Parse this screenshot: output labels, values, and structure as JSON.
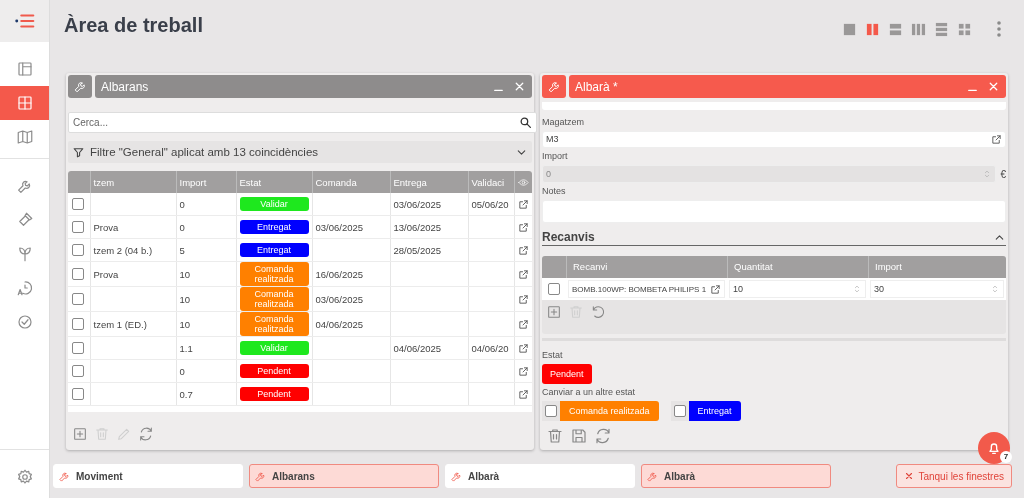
{
  "sidebar": {
    "menu_button": {
      "selected": false
    },
    "top_items": [
      {
        "selected": false
      },
      {
        "selected": true
      },
      {
        "selected": false
      }
    ],
    "tool_items": [
      {
        "selected": false
      },
      {
        "selected": false
      },
      {
        "selected": false
      },
      {
        "selected": false
      },
      {
        "selected": false
      }
    ],
    "settings": {
      "selected": false
    }
  },
  "title": "Àrea de treball",
  "layout_switcher": [
    {
      "selected": false
    },
    {
      "selected": true
    },
    {
      "selected": false
    },
    {
      "selected": false
    },
    {
      "selected": false
    },
    {
      "selected": false
    }
  ],
  "list_panel": {
    "title": "Albarans",
    "active": false,
    "search": {
      "placeholder": "Cerca..."
    },
    "filter": {
      "text": "Filtre \"General\" aplicat amb 13 coincidències",
      "expanded": false
    },
    "table": {
      "columns": [
        "tzem",
        "Import",
        "Estat",
        "Comanda",
        "Entrega",
        "Validaci"
      ],
      "rows": [
        {
          "checked": false,
          "import": "0",
          "status": {
            "label": "Validar",
            "color": "#1ee81e"
          },
          "entrega": "03/06/2025",
          "validacio": "05/06/20"
        },
        {
          "checked": false,
          "column_1": "Prova",
          "import": "0",
          "status": {
            "label": "Entregat",
            "color": "#0000ff"
          },
          "comanda": "03/06/2025",
          "entrega": "13/06/2025"
        },
        {
          "checked": false,
          "column_1": "tzem 2 (04 b.)",
          "import": "5",
          "status": {
            "label": "Entregat",
            "color": "#0000ff"
          },
          "entrega": "28/05/2025"
        },
        {
          "checked": false,
          "column_1": "Prova",
          "import": "10",
          "status": {
            "label": "Comanda realitzada",
            "color": "#ff8000"
          },
          "comanda": "16/06/2025"
        },
        {
          "checked": false,
          "import": "10",
          "status": {
            "label": "Comanda realitzada",
            "color": "#ff8000"
          },
          "comanda": "03/06/2025"
        },
        {
          "checked": false,
          "column_1": "tzem 1 (ED.)",
          "import": "10",
          "status": {
            "label": "Comanda realitzada",
            "color": "#ff8000"
          },
          "comanda": "04/06/2025"
        },
        {
          "checked": false,
          "import": "1.1",
          "status": {
            "label": "Validar",
            "color": "#1ee81e"
          },
          "entrega": "04/06/2025",
          "validacio": "04/06/20"
        },
        {
          "checked": false,
          "import": "0",
          "status": {
            "label": "Pendent",
            "color": "#ff0000"
          }
        },
        {
          "checked": false,
          "import": "0.7",
          "status": {
            "label": "Pendent",
            "color": "#ff0000"
          }
        }
      ]
    },
    "toolbar": [
      {
        "disabled": false
      },
      {
        "disabled": true
      },
      {
        "disabled": true
      },
      {
        "disabled": false
      }
    ]
  },
  "detail_panel": {
    "title": "Albarà *",
    "active": true,
    "fields": [
      {
        "label": "Magatzem",
        "value": "M3",
        "kind": "link",
        "disabled": false
      },
      {
        "label": "Import",
        "value": "0",
        "kind": "number",
        "disabled": true,
        "suffix": "€"
      },
      {
        "label": "Notes",
        "kind": "textarea",
        "disabled": false
      }
    ],
    "section": {
      "title": "Recanvis",
      "expanded": true,
      "columns": [
        "Recanvi",
        "Quantitat",
        "Import"
      ],
      "rows": [
        {
          "checked": false,
          "recanvi": "BOMB.100WP: BOMBETA PHILIPS 1",
          "quantitat": "10",
          "import": "30"
        }
      ],
      "toolbar": [
        {
          "disabled": false
        },
        {
          "disabled": true
        },
        {
          "disabled": false
        }
      ]
    },
    "state": {
      "label": "Estat",
      "value": {
        "label": "Pendent",
        "color": "#ff0000"
      }
    },
    "change_state": {
      "label": "Canviar a un altre estat",
      "options": [
        {
          "label": "Comanda realitzada",
          "color": "#ff8000",
          "checked": false
        },
        {
          "label": "Entregat",
          "color": "#0000ff",
          "checked": false
        }
      ]
    },
    "toolbar": [
      {
        "disabled": false
      },
      {
        "disabled": false
      },
      {
        "disabled": false
      }
    ]
  },
  "notifications": {
    "count": "7"
  },
  "taskbar": {
    "tabs": [
      {
        "label": "Moviment",
        "selected": false
      },
      {
        "label": "Albarans",
        "selected": true
      },
      {
        "label": "Albarà",
        "selected": false
      },
      {
        "label": "Albarà",
        "selected": true
      }
    ],
    "close_all": "Tanqui les finestres"
  }
}
